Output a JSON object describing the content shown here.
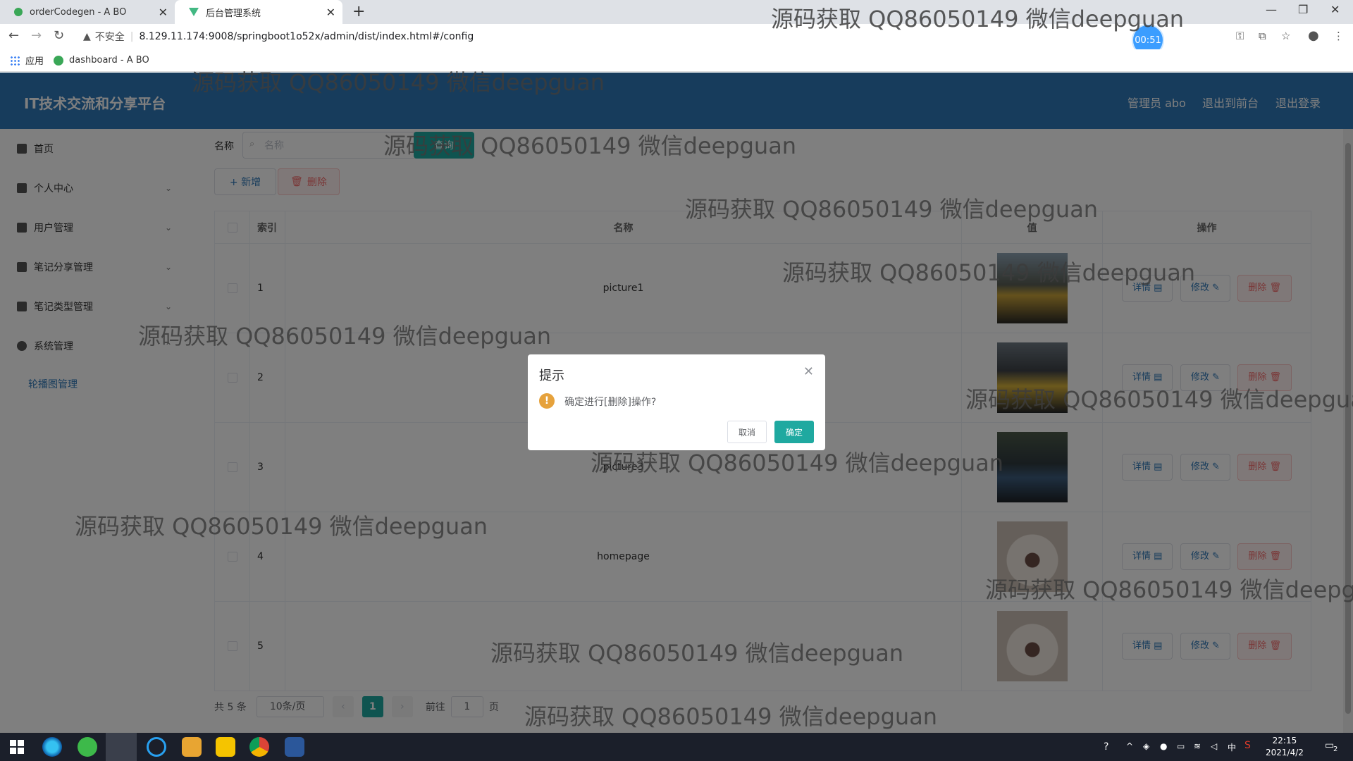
{
  "browser": {
    "tabs": [
      {
        "label": "orderCodegen - A BO",
        "active": false
      },
      {
        "label": "后台管理系统",
        "active": true
      }
    ],
    "new_tab": "+",
    "insecure_label": "不安全",
    "url": "8.129.11.174:9008/springboot1o52x/admin/dist/index.html#/config",
    "timer": "00:51",
    "bookmarks": [
      {
        "label": "应用",
        "icon": "apps-grid-icon"
      },
      {
        "label": "dashboard - A BO",
        "icon": "dashboard-favicon"
      }
    ]
  },
  "header": {
    "title": "IT技术交流和分享平台",
    "user": "管理员 abo",
    "back_to_front": "退出到前台",
    "logout": "退出登录"
  },
  "sidebar": {
    "items": [
      {
        "label": "首页",
        "icon": "home-icon",
        "expandable": false
      },
      {
        "label": "个人中心",
        "icon": "user-icon",
        "expandable": true
      },
      {
        "label": "用户管理",
        "icon": "user-manage-icon",
        "expandable": true
      },
      {
        "label": "笔记分享管理",
        "icon": "note-share-icon",
        "expandable": true
      },
      {
        "label": "笔记类型管理",
        "icon": "note-type-icon",
        "expandable": true
      },
      {
        "label": "系统管理",
        "icon": "system-icon",
        "expandable": true
      }
    ],
    "sub_item": "轮播图管理"
  },
  "search": {
    "label": "名称",
    "placeholder": "名称",
    "query_button": "查询"
  },
  "toolbar": {
    "add_label": "+ 新增",
    "delete_label": "删除"
  },
  "table": {
    "columns": [
      "索引",
      "名称",
      "值",
      "操作"
    ],
    "rows": [
      {
        "index": "1",
        "name": "picture1",
        "thumb": "car-race-image"
      },
      {
        "index": "2",
        "name": "",
        "thumb": "car-race-image"
      },
      {
        "index": "3",
        "name": "picture3",
        "thumb": "car-race-image"
      },
      {
        "index": "4",
        "name": "homepage",
        "thumb": "yawning-cat-image"
      },
      {
        "index": "5",
        "name": "",
        "thumb": "yawning-cat-image"
      }
    ],
    "actions": {
      "detail": "详情",
      "edit": "修改",
      "remove": "删除"
    }
  },
  "pagination": {
    "total": "共 5 条",
    "page_size": "10条/页",
    "current_page": "1",
    "jump_prefix": "前往",
    "jump_value": "1",
    "jump_suffix": "页"
  },
  "dialog": {
    "title": "提示",
    "message": "确定进行[删除]操作?",
    "cancel": "取消",
    "confirm": "确定"
  },
  "taskbar": {
    "time": "22:15",
    "date": "2021/4/2",
    "ime": "中",
    "notifications": "2"
  },
  "watermark": "源码获取 QQ86050149 微信deepguan",
  "colors": {
    "header": "#2f78b8",
    "primary": "#1fa9a0",
    "danger": "#f56c6c",
    "warning": "#e6a23c"
  }
}
